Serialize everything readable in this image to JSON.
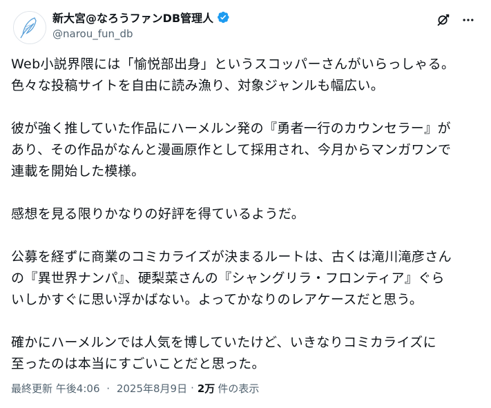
{
  "author": {
    "display_name": "新大宮@なろうファンDB管理人",
    "handle": "@narou_fun_db",
    "verified": true,
    "avatar_icon": "quill-feather-icon"
  },
  "actions": {
    "grok_icon": "grok-icon",
    "more_icon": "more-dots-icon"
  },
  "paragraphs": [
    {
      "lines": [
        "Web小説界隈には「愉悦部出身」というスコッパーさんがいらっしゃる。",
        "色々な投稿サイトを自由に読み漁り、対象ジャンルも幅広い。"
      ]
    },
    {
      "lines": [
        "彼が強く推していた作品にハーメルン発の『勇者一行のカウンセラー』が",
        "あり、その作品がなんと漫画原作として採用され、今月からマンガワンで",
        "連載を開始した模様。"
      ]
    },
    {
      "lines": [
        "感想を見る限りかなりの好評を得ているようだ。"
      ]
    },
    {
      "lines": [
        "公募を経ずに商業のコミカライズが決まるルートは、古くは滝川滝彦さん",
        "の『異世界ナンパ』、硬梨菜さんの『シャングリラ・フロンティア』ぐら",
        "いしかすぐに思い浮かばない。よってかなりのレアケースだと思う。"
      ]
    },
    {
      "lines": [
        "確かにハーメルンでは人気を博していたけど、いきなりコミカライズに",
        "至ったのは本当にすごいことだと思った。"
      ]
    }
  ],
  "meta": {
    "updated_label": "最終更新",
    "time": "午後4:06",
    "separator": "·",
    "date": "2025年8月9日",
    "views_count": "2万",
    "views_label": "件の表示"
  },
  "colors": {
    "text": "#0f1419",
    "secondary": "#536471",
    "verified_blue": "#1d9bf0",
    "avatar_accent": "#5aa0d8"
  }
}
